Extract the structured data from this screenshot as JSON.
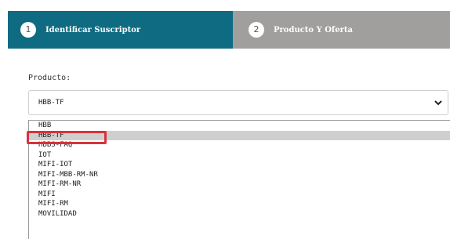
{
  "stepper": {
    "steps": [
      {
        "number": "1",
        "label": "Identificar Suscriptor"
      },
      {
        "number": "2",
        "label": "Producto Y Oferta"
      }
    ]
  },
  "form": {
    "product_label": "Producto:",
    "selected_value": "HBB-TF",
    "options": [
      "HBB",
      "HBB-TF",
      "HBBS-FAQ",
      "IOT",
      "MIFI-IOT",
      "MIFI-MBB-RM-NR",
      "MIFI-RM-NR",
      "MIFI",
      "MIFI-RM",
      "MOVILIDAD"
    ],
    "highlighted_option": "HBB-TF"
  },
  "colors": {
    "active_step": "#0e6b82",
    "inactive_step": "#a19e9e",
    "annotation": "#d8323a",
    "highlight": "#cfcfcf"
  },
  "icons": {
    "dropdown": "chevron-down-icon"
  }
}
